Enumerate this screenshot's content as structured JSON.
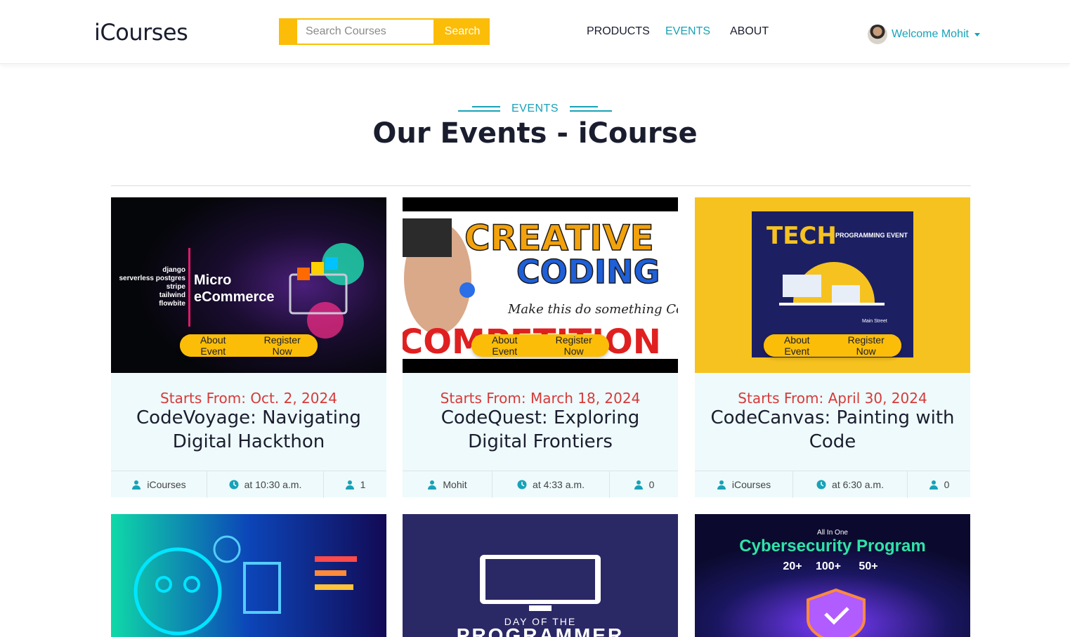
{
  "header": {
    "brand": "iCourses",
    "search": {
      "placeholder": "Search Courses",
      "button": "Search"
    },
    "nav": [
      {
        "label": "PRODUCTS"
      },
      {
        "label": "EVENTS"
      },
      {
        "label": "ABOUT"
      }
    ],
    "user": {
      "welcome": "Welcome Mohit"
    }
  },
  "section": {
    "kicker": "EVENTS",
    "title": "Our Events - iCourse"
  },
  "cards": [
    {
      "image_text": {
        "tags": "django\nserverless postgres\nstripe\ntailwind\nflowbite",
        "line1": "Micro",
        "line2": "eCommerce"
      },
      "about": "About Event",
      "register": "Register Now",
      "date": "Starts From: Oct. 2, 2024",
      "title": "CodeVoyage: Navigating Digital Hackthon",
      "host": "iCourses",
      "time": "at 10:30 a.m.",
      "count": "1"
    },
    {
      "image_text": {
        "line1": "CREATIVE",
        "line2": "CODING",
        "line3": "Make this do something Cool",
        "line4": "COMPETITION"
      },
      "about": "About Event",
      "register": "Register Now",
      "date": "Starts From: March 18, 2024",
      "title": "CodeQuest: Exploring Digital Frontiers",
      "host": "Mohit",
      "time": "at 4:33 a.m.",
      "count": "0"
    },
    {
      "image_text": {
        "line1": "TECH",
        "line2": "PROGRAMMING EVENT",
        "line3": "Main Street"
      },
      "about": "About Event",
      "register": "Register Now",
      "date": "Starts From: April 30, 2024",
      "title": "CodeCanvas: Painting with Code",
      "host": "iCourses",
      "time": "at 6:30 a.m.",
      "count": "0"
    }
  ],
  "lower_cards": [
    {
      "image_text": ""
    },
    {
      "image_text": "DAY OF THE PROGRAMMER"
    },
    {
      "image_text": {
        "top": "All In One",
        "title": "Cybersecurity Program",
        "stats": [
          "20+",
          "100+",
          "50+"
        ]
      }
    }
  ]
}
